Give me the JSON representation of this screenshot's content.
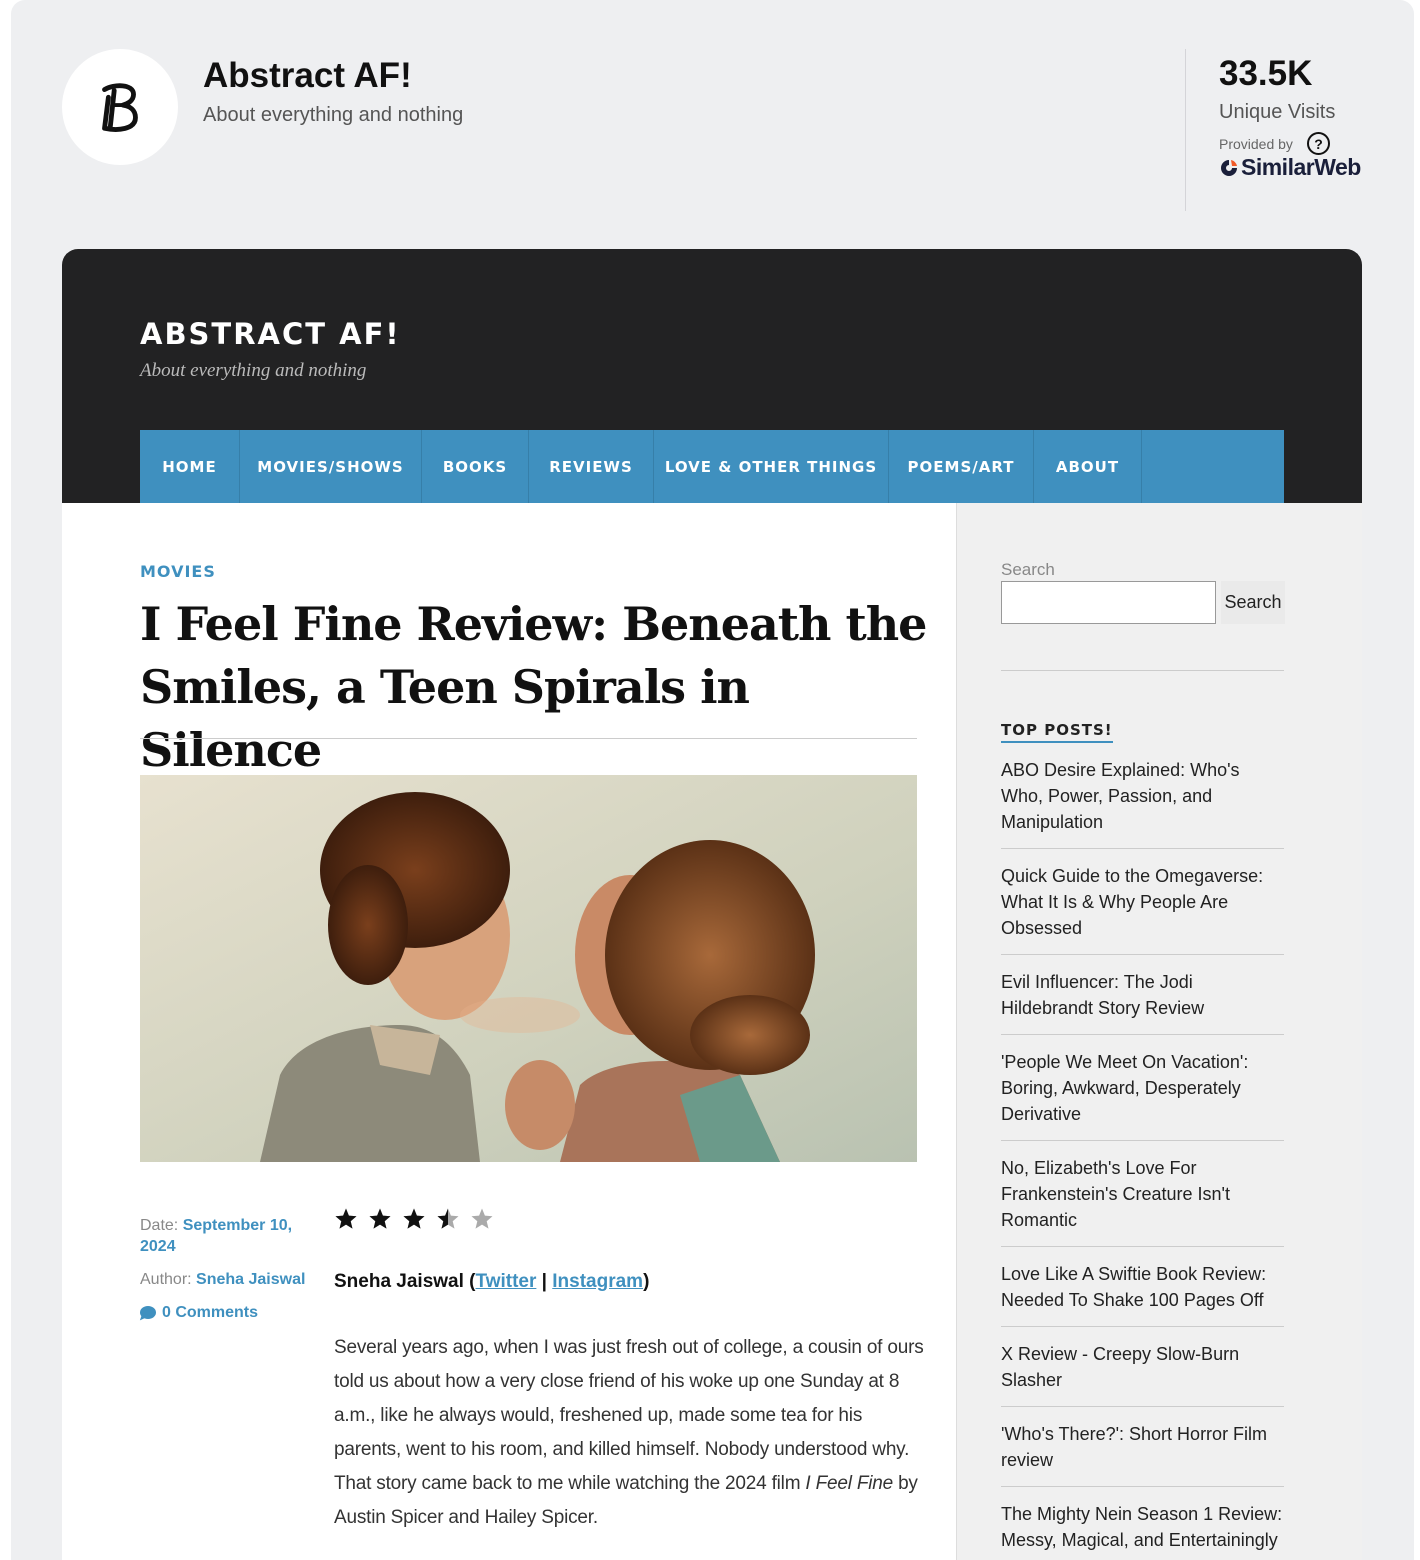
{
  "brand": {
    "title": "Abstract AF!",
    "subtitle": "About everything and nothing",
    "logo_icon": "b-logo-icon"
  },
  "stats": {
    "value": "33.5K",
    "label": "Unique Visits",
    "help": "?",
    "provided_by": "Provided by",
    "provider": "SimilarWeb"
  },
  "site": {
    "title": "ABSTRACT AF!",
    "description": "About everything and nothing",
    "nav": [
      "HOME",
      "MOVIES/SHOWS",
      "BOOKS",
      "REVIEWS",
      "LOVE & OTHER THINGS",
      "POEMS/ART",
      "ABOUT"
    ]
  },
  "article": {
    "category": "MOVIES",
    "title": "I Feel Fine Review: Beneath the Smiles, a Teen Spirals in Silence",
    "date_label": "Date:",
    "date": "September 10, 2024",
    "author_label": "Author:",
    "author": "Sneha Jaiswal",
    "comments": "0 Comments",
    "rating": 3.5,
    "rating_max": 5,
    "byline_name": "Sneha Jaiswal (",
    "byline_twitter": "Twitter",
    "byline_sep": " | ",
    "byline_instagram": "Instagram",
    "byline_end": ")",
    "para_before": "Several years ago, when I was just fresh out of college, a cousin of ours told us about how a very close friend of his woke up one Sunday at 8 a.m., like he always would, freshened up, made some tea for his parents, went to his room, and killed himself. Nobody understood why. That story came back to me while watching the 2024 film ",
    "para_film": "I Feel Fine",
    "para_after": " by Austin Spicer and Hailey Spicer."
  },
  "sidebar": {
    "search_label": "Search",
    "search_button": "Search",
    "top_posts_title": "TOP POSTS!",
    "posts": [
      "ABO Desire Explained: Who's Who, Power, Passion, and Manipulation",
      "Quick Guide to the Omegaverse: What It Is & Why People Are Obsessed",
      "Evil Influencer: The Jodi Hildebrandt Story Review",
      "'People We Meet On Vacation': Boring, Awkward, Desperately Derivative",
      "No, Elizabeth's Love For Frankenstein's Creature Isn't Romantic",
      "Love Like A Swiftie Book Review: Needed To Shake 100 Pages Off",
      "X Review - Creepy Slow-Burn Slasher",
      "'Who's There?': Short Horror Film review",
      "The Mighty Nein Season 1 Review: Messy, Magical, and Entertainingly"
    ]
  },
  "colors": {
    "accent": "#3f90bf",
    "header_bg": "#222223",
    "page_bg": "#eeeff1"
  }
}
